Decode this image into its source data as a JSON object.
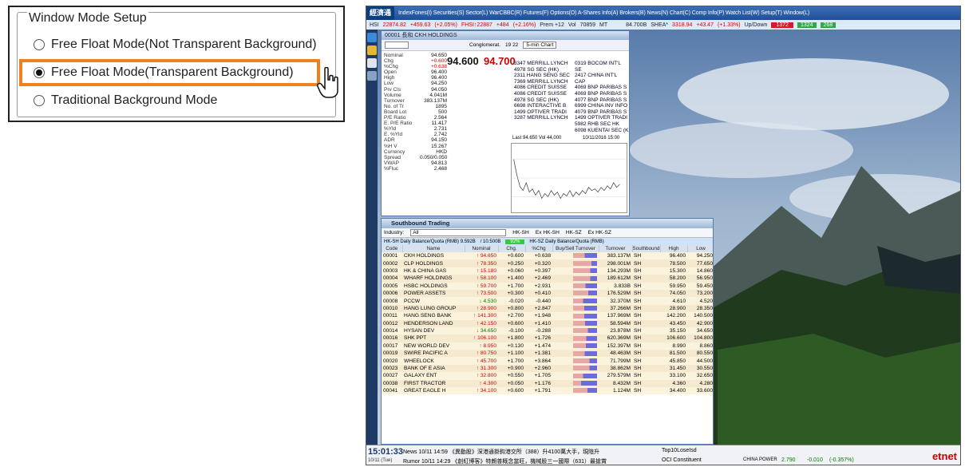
{
  "dialog": {
    "legend": "Window Mode Setup",
    "options": [
      {
        "label": "Free Float Mode(Not Transparent Background)",
        "checked": false
      },
      {
        "label": "Free Float Mode(Transparent Background)",
        "checked": true
      },
      {
        "label": "Traditional Background Mode",
        "checked": false
      }
    ],
    "highlight_color": "#f0801c"
  },
  "app": {
    "logo": "經濟通",
    "menu": "IndexFones(I)  Securities(S)  Sector(L)  WarCBBC(R)  Futures(F)  Options(O)  A-Shares Info(A)  Brokers(B)  News(N)  Chart(C)  Comp Info(P)  Watch List(W)  Setup(T)  Window(L)",
    "ticker": {
      "hsi_label": "HSI",
      "hsi_value": "22874.82",
      "hsi_change": "+459.63",
      "hsi_pct": "(+2.05%)",
      "fhsi": "FHSI↑22887",
      "fhsi_change": "+484",
      "fhsi_pct": "(+2.16%)",
      "prem": "Prem +12",
      "vol_label": "Vol",
      "vol": "70859",
      "mt": "MT",
      "turnover": "84.700B",
      "shea_label": "SHEA*",
      "shea": "3318.94",
      "shea_change": "+43.47",
      "shea_pct": "(+1.33%)",
      "updown": "Up/Down",
      "up_count": "1372",
      "down_count": "1324",
      "flat_count": "268"
    },
    "quote": {
      "title": "00001 長和 CKH HOLDINGS",
      "sector": "Conglomerat.",
      "range": "19  22",
      "chart_mode": "5-min Chart",
      "bid": "94.600",
      "ask": "94.700",
      "nominal": "94.650",
      "labels": [
        "Nominal",
        "Chg",
        "%Chg",
        "Open",
        "High",
        "Low",
        "Prv Cls",
        "Volume",
        "Turnover",
        "No. of Tr",
        "Board Lot",
        "P/E Ratio",
        "E. P/E Ratio",
        "%Yld",
        "E. %Yld",
        "ADR",
        "%H V",
        "Currency",
        "Spread",
        "VWAP",
        "%Fluc"
      ],
      "values": [
        "94.650",
        "+0.600",
        "+0.638",
        "96.400",
        "96.400",
        "94.250",
        "94.050",
        "4.041M",
        "383.137M",
        "1895",
        "500",
        "2.564",
        "11.417",
        "2.731",
        "2.742",
        "94.150",
        "15.267",
        "HKD",
        "0.050/0.050",
        "94.813",
        "2.468"
      ],
      "brokers": [
        "3347 MERRILL LYNCH",
        "4978 SG SEC (HK)",
        "2311 HANG SENG SEC",
        "7369 MERRILL LYNCH",
        "4086 CREDIT SUISSE",
        "4086 CREDIT SUISSE",
        "4978 SG SEC (HK)",
        "6698 INTERACTIVE B",
        "1499 OPTIVER TRADI",
        "3287 MERRILL LYNCH"
      ],
      "brokers_ask": [
        "0319 BOCOM INT'L SE",
        "2417 CHINA INT'L CAP",
        "4069 BNP PARIBAS S",
        "4069 BNP PARIBAS S",
        "4077 BNP PARIBAS S",
        "6999 CHINA INV INFO",
        "4079 BNP PARIBAS S",
        "1499 OPTIVER TRADI",
        "5982 RHB SEC HK",
        "6098 KUENTAI SEC (K"
      ],
      "last_label": "Last 94.650   Vol 44,000",
      "time": "10/11/2016 15:00"
    },
    "south": {
      "title": "Southbound Trading",
      "industry_label": "Industry:",
      "industry_value": "All",
      "filters": [
        "HK-SH",
        "Ex HK-SH",
        "HK-SZ",
        "Ex HK-SZ"
      ],
      "quota_left": "HK-SH Daily Balance/Quota (RMB) 9.592B",
      "quota_total": "/ 10.500B",
      "quota_pct": "92%",
      "quota_right": "HK-SZ Daily Balance/Quota (RMB)",
      "columns": [
        "Code",
        "Name",
        "Nominal",
        "Chg.",
        "%Chg",
        "Buy/Sell Turnover",
        "Turnover",
        "Southbound",
        "High",
        "Low"
      ],
      "rows": [
        {
          "code": "00001",
          "name": "CKH HOLDINGS",
          "nominal": "94.650",
          "chg": "+0.600",
          "pchg": "+0.638",
          "buy": 49,
          "turnover": "383.137M",
          "sb": "SH",
          "high": "96.400",
          "low": "94.250"
        },
        {
          "code": "00002",
          "name": "CLP HOLDINGS",
          "nominal": "78.350",
          "chg": "+0.250",
          "pchg": "+0.320",
          "buy": 76,
          "turnover": "298.001M",
          "sb": "SH",
          "high": "78.500",
          "low": "77.650"
        },
        {
          "code": "00003",
          "name": "HK & CHINA GAS",
          "nominal": "15.180",
          "chg": "+0.060",
          "pchg": "+0.397",
          "buy": 71,
          "turnover": "134.293M",
          "sb": "SH",
          "high": "15.300",
          "low": "14.860"
        },
        {
          "code": "00004",
          "name": "WHARF HOLDINGS",
          "nominal": "58.100",
          "chg": "+1.400",
          "pchg": "+2.469",
          "buy": 72,
          "turnover": "189.612M",
          "sb": "SH",
          "high": "58.200",
          "low": "56.950"
        },
        {
          "code": "00005",
          "name": "HSBC HOLDINGS",
          "nominal": "59.700",
          "chg": "+1.700",
          "pchg": "+2.931",
          "buy": 51,
          "turnover": "3.833B",
          "sb": "SH",
          "high": "59.950",
          "low": "59.450"
        },
        {
          "code": "00006",
          "name": "POWER ASSETS",
          "nominal": "73.500",
          "chg": "+0.300",
          "pchg": "+0.410",
          "buy": 64,
          "turnover": "176.529M",
          "sb": "SH",
          "high": "74.050",
          "low": "73.200"
        },
        {
          "code": "00008",
          "name": "PCCW",
          "nominal": "4.530",
          "chg": "-0.020",
          "pchg": "-0.440",
          "buy": 42,
          "turnover": "32.370M",
          "sb": "SH",
          "high": "4.610",
          "low": "4.520"
        },
        {
          "code": "00010",
          "name": "HANG LUNG GROUP",
          "nominal": "28.900",
          "chg": "+0.800",
          "pchg": "+2.847",
          "buy": 47,
          "turnover": "37.266M",
          "sb": "SH",
          "high": "28.900",
          "low": "28.350"
        },
        {
          "code": "00011",
          "name": "HANG SENG BANK",
          "nominal": "141.300",
          "chg": "+2.700",
          "pchg": "+1.948",
          "buy": 46,
          "turnover": "137.969M",
          "sb": "SH",
          "high": "142.200",
          "low": "140.500"
        },
        {
          "code": "00012",
          "name": "HENDERSON LAND",
          "nominal": "42.150",
          "chg": "+0.600",
          "pchg": "+1.410",
          "buy": 50,
          "turnover": "58.594M",
          "sb": "SH",
          "high": "43.450",
          "low": "42.900"
        },
        {
          "code": "00014",
          "name": "HYSAN DEV",
          "nominal": "34.650",
          "chg": "-0.100",
          "pchg": "-0.288",
          "buy": 62,
          "turnover": "23.878M",
          "sb": "SH",
          "high": "35.150",
          "low": "34.650"
        },
        {
          "code": "00016",
          "name": "SHK PPT",
          "nominal": "106.100",
          "chg": "+1.800",
          "pchg": "+1.726",
          "buy": 55,
          "turnover": "620.369M",
          "sb": "SH",
          "high": "106.600",
          "low": "104.800"
        },
        {
          "code": "00017",
          "name": "NEW WORLD DEV",
          "nominal": "8.950",
          "chg": "+0.130",
          "pchg": "+1.474",
          "buy": 54,
          "turnover": "152.397M",
          "sb": "SH",
          "high": "8.990",
          "low": "8.860"
        },
        {
          "code": "00019",
          "name": "SWIRE PACIFIC A",
          "nominal": "80.750",
          "chg": "+1.100",
          "pchg": "+1.381",
          "buy": 49,
          "turnover": "48.463M",
          "sb": "SH",
          "high": "81.500",
          "low": "80.550"
        },
        {
          "code": "00020",
          "name": "WHEELOCK",
          "nominal": "45.700",
          "chg": "+1.700",
          "pchg": "+3.864",
          "buy": 69,
          "turnover": "71.799M",
          "sb": "SH",
          "high": "45.850",
          "low": "44.500"
        },
        {
          "code": "00023",
          "name": "BANK OF E ASIA",
          "nominal": "31.300",
          "chg": "+0.900",
          "pchg": "+2.960",
          "buy": 69,
          "turnover": "38.862M",
          "sb": "SH",
          "high": "31.450",
          "low": "30.550"
        },
        {
          "code": "00027",
          "name": "GALAXY ENT",
          "nominal": "32.800",
          "chg": "+0.550",
          "pchg": "+1.705",
          "buy": 41,
          "turnover": "279.579M",
          "sb": "SH",
          "high": "33.100",
          "low": "32.650"
        },
        {
          "code": "00038",
          "name": "FIRST TRACTOR",
          "nominal": "4.300",
          "chg": "+0.050",
          "pchg": "+1.176",
          "buy": 33,
          "turnover": "8.432M",
          "sb": "SH",
          "high": "4.360",
          "low": "4.280"
        },
        {
          "code": "00041",
          "name": "GREAT EAGLE H",
          "nominal": "34.100",
          "chg": "+0.600",
          "pchg": "+1.791",
          "buy": 60,
          "turnover": "1.124M",
          "sb": "SH",
          "high": "34.400",
          "low": "33.600"
        }
      ]
    },
    "news": {
      "clock": "15:01:33",
      "date": "10/11 (Tue)",
      "line1": "News  10/11 14:59  《異動股》深港通掛鈎港交所（388）升4100萬大手，現陰升",
      "line2": "Rumor 10/11 14:29  《創紅博客》特朗普概念當旺，機械股三一國際（631）最搶賞",
      "right1": "Top10LoseIsd",
      "right2": "OCI Constituent",
      "cp_label": "CHINA POWER",
      "cp_value": "2.790",
      "cp_change": "-0.010",
      "cp_pct": "(-0.357%)",
      "brand": "etnet"
    }
  }
}
